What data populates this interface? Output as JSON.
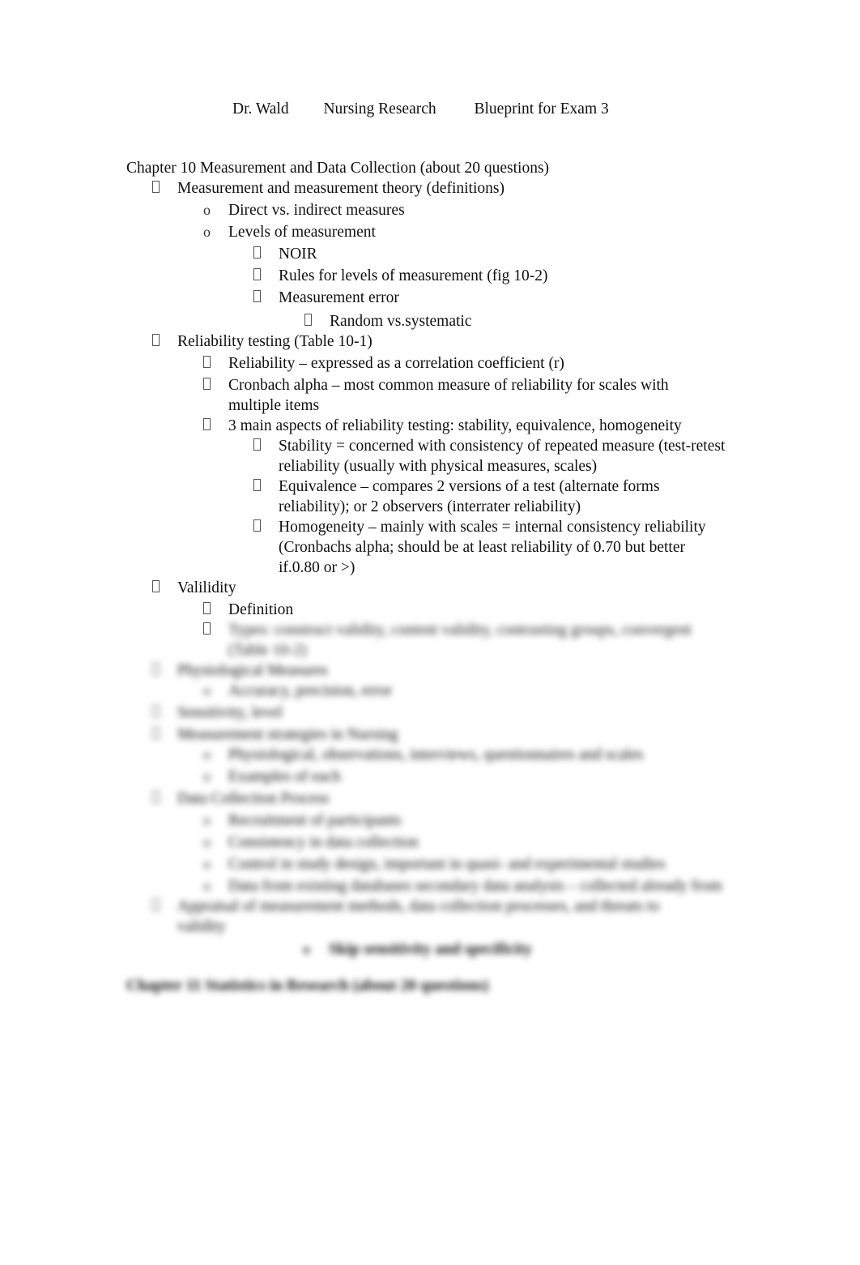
{
  "header": {
    "author": "Dr. Wald",
    "course": "Nursing Research",
    "title": "Blueprint for Exam 3"
  },
  "chapter10": {
    "heading": "Chapter 10 Measurement and Data Collection (about 20 questions)",
    "items": {
      "measurement_theory": "Measurement and measurement theory (definitions)",
      "direct_indirect": "Direct vs. indirect measures",
      "levels": "Levels of measurement",
      "noir": "NOIR",
      "rules": "Rules for levels of measurement (fig 10-2)",
      "error": "Measurement error",
      "random_systematic": "Random vs.systematic",
      "reliability_testing": "Reliability testing (Table 10-1)",
      "reliability_r": "Reliability – expressed as a correlation coefficient (r)",
      "cronbach": "Cronbach alpha – most common measure of reliability for scales with multiple items",
      "three_aspects": "3 main aspects of reliability testing: stability, equivalence, homogeneity",
      "stability": "Stability = concerned with consistency of repeated measure (test-retest reliability (usually with physical measures, scales)",
      "equivalence": "Equivalence – compares 2 versions of a test (alternate forms reliability); or 2 observers (interrater reliability)",
      "homogeneity": "Homogeneity – mainly with scales = internal consistency reliability (Cronbachs alpha; should be at least reliability of  0.70 but better if.0.80 or >)",
      "validity": "Valilidity",
      "definition": "Definition"
    },
    "blurred": {
      "b1": "Types: construct validity, content validity, contrasting groups, convergent (Table 10-2)",
      "b2": "Physiological Measures",
      "b3": "Accuracy, precision, error",
      "b4": "Sensitivity, level",
      "b5": "Measurement strategies in Nursing",
      "b6": "Physiological, observations, interviews, questionnaires and scales",
      "b7": "Examples of each",
      "b8": "Data Collection Process",
      "b9": "Recruitment of participants",
      "b10": "Consistency in data collection",
      "b11": "Control in study design, important in quasi- and experimental studies",
      "b12": "Data from existing databases secondary data analysis – collected already from",
      "b13": "Appraisal of measurement methods, data collection processes, and threats to validity",
      "b14": "Skip sensitivity and specificity",
      "b15": "Chapter 11 Statistics in Research (about 20 questions)"
    }
  }
}
